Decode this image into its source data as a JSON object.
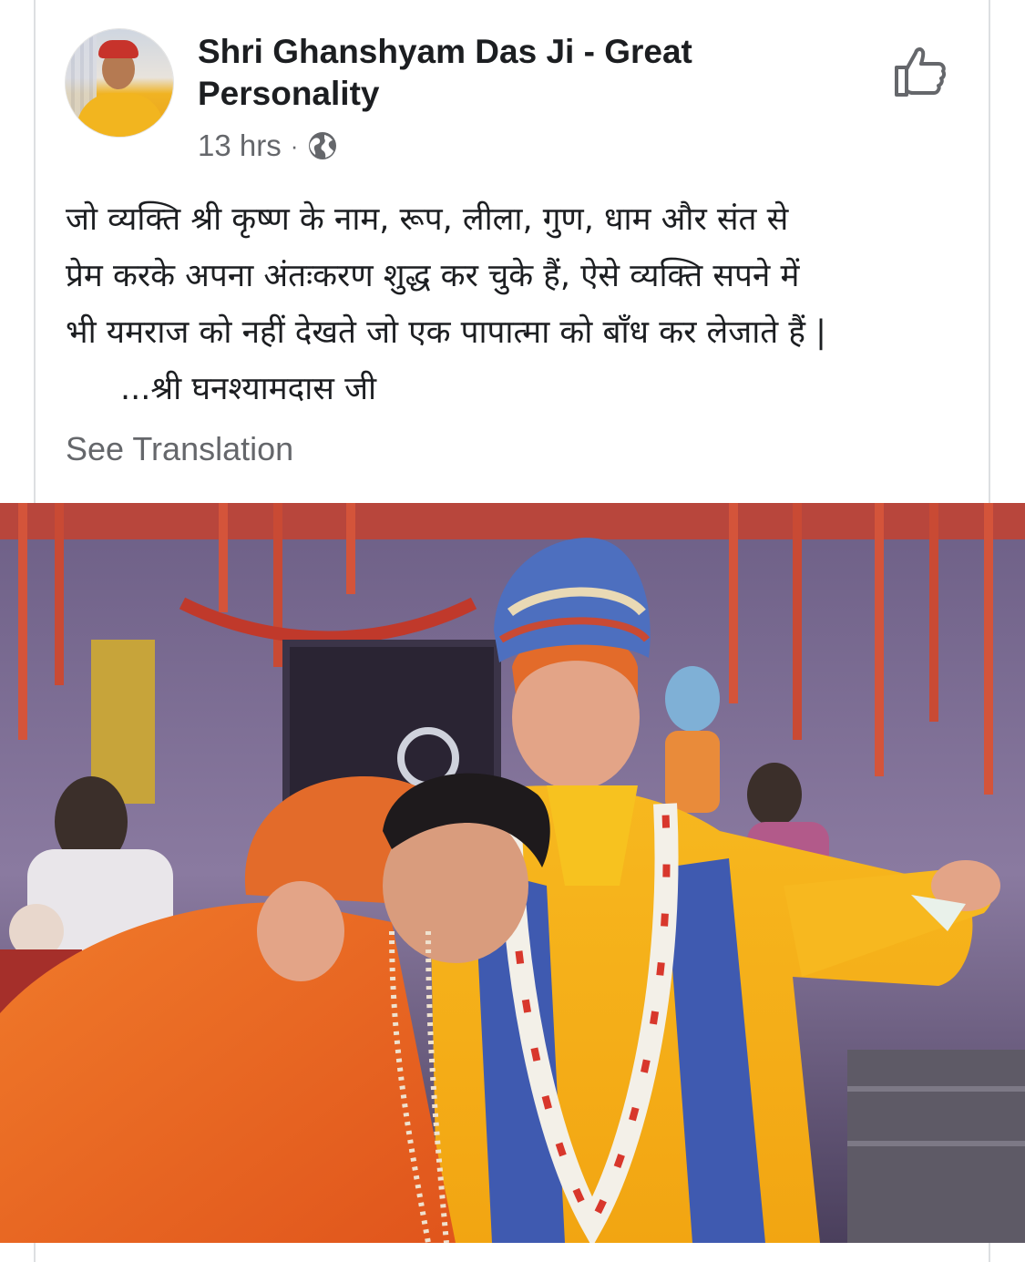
{
  "post": {
    "page_name": "Shri Ghanshyam Das Ji - Great Personality",
    "time": "13 hrs",
    "separator": "·",
    "privacy_icon": "globe-icon",
    "like_icon": "thumbs-up-icon",
    "text_lines": [
      "जो व्यक्ति श्री कृष्ण के नाम, रूप, लीला, गुण, धाम और संत से",
      "प्रेम करके अपना अंतःकरण शुद्ध कर चुके हैं, ऐसे व्यक्ति सपने में",
      "भी यमराज को नहीं देखते जो एक पापात्मा को बाँध कर लेजाते हैं |",
      "...श्री घनश्यामदास जी"
    ],
    "see_translation": "See Translation"
  }
}
